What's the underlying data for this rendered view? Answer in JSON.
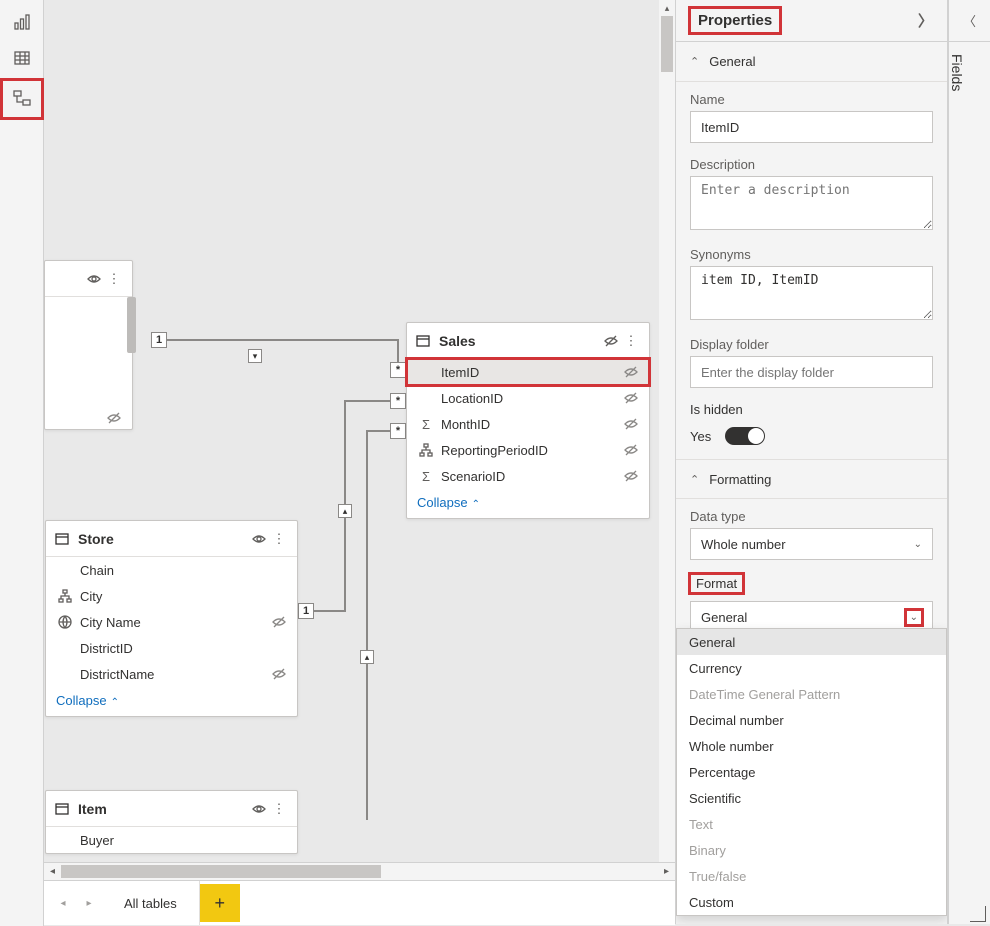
{
  "leftRail": {
    "reportIcon": "report-view",
    "dataIcon": "data-view",
    "modelIcon": "model-view"
  },
  "canvas": {
    "tables": {
      "anon": {
        "title": ""
      },
      "sales": {
        "title": "Sales",
        "fields": [
          "ItemID",
          "LocationID",
          "MonthID",
          "ReportingPeriodID",
          "ScenarioID"
        ],
        "collapse": "Collapse"
      },
      "store": {
        "title": "Store",
        "fields": [
          "Chain",
          "City",
          "City Name",
          "DistrictID",
          "DistrictName"
        ],
        "collapse": "Collapse"
      },
      "item": {
        "title": "Item",
        "fields": [
          "Buyer"
        ]
      }
    },
    "rel": {
      "one": "1",
      "many": "*"
    }
  },
  "tabs": {
    "allTables": "All tables"
  },
  "properties": {
    "title": "Properties",
    "sections": {
      "general": "General",
      "formatting": "Formatting"
    },
    "general": {
      "nameLabel": "Name",
      "nameValue": "ItemID",
      "descLabel": "Description",
      "descPlaceholder": "Enter a description",
      "synLabel": "Synonyms",
      "synValue": "item ID, ItemID",
      "folderLabel": "Display folder",
      "folderPlaceholder": "Enter the display folder",
      "hiddenLabel": "Is hidden",
      "hiddenValue": "Yes"
    },
    "formatting": {
      "dataTypeLabel": "Data type",
      "dataTypeValue": "Whole number",
      "formatLabel": "Format",
      "formatValue": "General",
      "options": [
        "General",
        "Currency",
        "DateTime General Pattern",
        "Decimal number",
        "Whole number",
        "Percentage",
        "Scientific",
        "Text",
        "Binary",
        "True/false",
        "Custom"
      ],
      "disabled": [
        "DateTime General Pattern",
        "Text",
        "Binary",
        "True/false"
      ]
    }
  },
  "fieldsPane": {
    "title": "Fields"
  }
}
